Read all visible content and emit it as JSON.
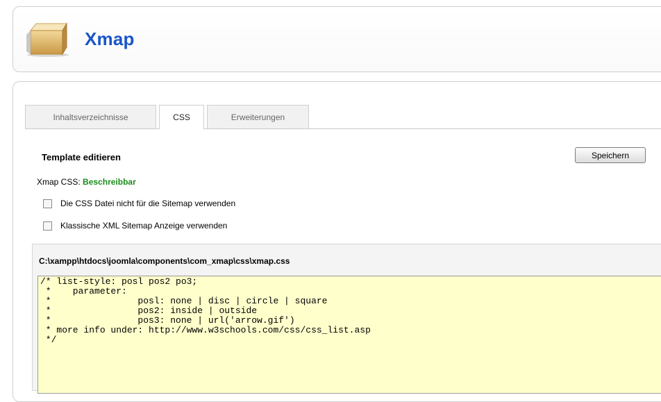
{
  "header": {
    "title": "Xmap",
    "logo_icon": "package-box-icon"
  },
  "tabs": [
    {
      "label": "Inhaltsverzeichnisse",
      "active": false
    },
    {
      "label": "CSS",
      "active": true
    },
    {
      "label": "Erweiterungen",
      "active": false
    }
  ],
  "editor_section": {
    "title": "Template editieren",
    "save_label": "Speichern",
    "status_label": "Xmap CSS:",
    "status_value": "Beschreibbar",
    "status_color": "#1a8c1a",
    "options": [
      {
        "label": "Die CSS Datei nicht für die Sitemap verwenden",
        "checked": false
      },
      {
        "label": "Klassische XML Sitemap Anzeige verwenden",
        "checked": false
      }
    ],
    "file_path": "C:\\xampp\\htdocs\\joomla\\components\\com_xmap\\css\\xmap.css",
    "code": "/* list-style: posl pos2 po3;\n *    parameter:\n *                posl: none | disc | circle | square\n *                pos2: inside | outside\n *                pos3: none | url('arrow.gif')\n * more info under: http://www.w3schools.com/css/css_list.asp\n */"
  }
}
